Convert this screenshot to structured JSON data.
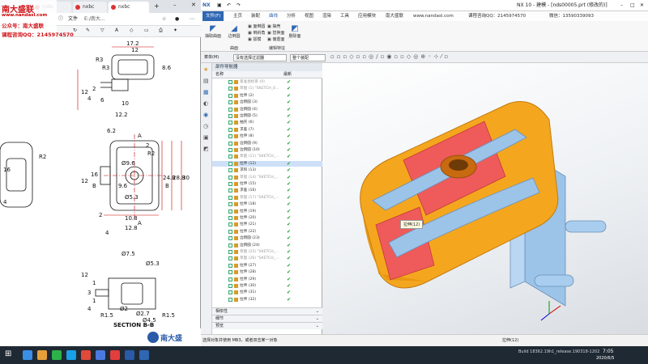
{
  "browser": {
    "tabs": [
      {
        "label": "nxbc"
      },
      {
        "label": "nxbc"
      },
      {
        "label": "nxbc"
      }
    ],
    "address_prefix": "文件",
    "address_path": "E:/南大...",
    "branding": {
      "name": "南大盛联",
      "site": "www.nandasl.com",
      "wechat_label": "公众号：南大盛联",
      "qq_label": "课程咨询QQ：2145974570"
    },
    "drawing": {
      "dims": [
        "17.2",
        "12",
        "R3",
        "R3",
        "8.6",
        "2",
        "4",
        "6",
        "10",
        "12",
        "12.2",
        "6.2",
        "A",
        "A",
        "2",
        "R2",
        "B",
        "B",
        "12",
        "16",
        "9.6",
        "24.8",
        "28.8",
        "30",
        "R2",
        "Ø9.6",
        "Ø5.3",
        "10.8",
        "12.8",
        "2",
        "4",
        "4",
        "Ø7.5",
        "Ø5.3",
        "12",
        "1",
        "3",
        "1",
        "4",
        "R1.5",
        "Ø2.7",
        "R1.5",
        "Ø2",
        "Ø4.5",
        "16"
      ],
      "section_label": "SECTION B-B"
    },
    "bottom_logo": "南大盛"
  },
  "nx": {
    "title": "NX 10 - 建模 - [nds00005.prt (修改的)]",
    "app_label": "NX",
    "menu": [
      "文件(F)",
      "主页",
      "装配",
      "曲线",
      "分析",
      "视图",
      "渲染",
      "工具",
      "应用模块",
      "南大盛联",
      "www.nandasl.com",
      "课程咨询QQ：2145974570",
      "微信：13590339093"
    ],
    "active_menu_index": 3,
    "ribbon": {
      "buttons": [
        "抽取曲面",
        "边倒圆",
        "面倒圆",
        "倒斜角",
        "拔模",
        "抽壳",
        "替换面",
        "偏置面",
        "删除面"
      ],
      "groups": [
        "曲面",
        "编辑特征"
      ]
    },
    "commandbar": {
      "menu_label": "菜单(M)",
      "filter_value": "没有选择过滤器",
      "scope_value": "整个装配"
    },
    "navigator": {
      "title": "部件导航器",
      "col_name": "名称",
      "col_latest": "最新",
      "rows": [
        {
          "label": "基准坐标系 (0)",
          "hidden": true
        },
        {
          "label": "草图 (1) \"SKETCH_0...",
          "hidden": true
        },
        {
          "label": "拉伸 (2)"
        },
        {
          "label": "边倒圆 (3)"
        },
        {
          "label": "边倒圆 (4)"
        },
        {
          "label": "边倒圆 (5)"
        },
        {
          "label": "抽壳 (6)"
        },
        {
          "label": "求差 (7)"
        },
        {
          "label": "拉伸 (8)"
        },
        {
          "label": "边倒圆 (9)"
        },
        {
          "label": "边倒圆 (10)"
        },
        {
          "label": "草图 (11) \"SKETCH_...",
          "hidden": true
        },
        {
          "label": "拉伸 (12)",
          "selected": true
        },
        {
          "label": "求和 (13)"
        },
        {
          "label": "草图 (14) \"SKETCH_...",
          "hidden": true
        },
        {
          "label": "拉伸 (15)"
        },
        {
          "label": "求差 (16)"
        },
        {
          "label": "草图 (17) \"SKETCH_...",
          "hidden": true
        },
        {
          "label": "拉伸 (18)"
        },
        {
          "label": "拉伸 (19)"
        },
        {
          "label": "拉伸 (20)"
        },
        {
          "label": "拉伸 (21)"
        },
        {
          "label": "拉伸 (22)"
        },
        {
          "label": "边倒圆 (23)"
        },
        {
          "label": "边倒圆 (24)"
        },
        {
          "label": "草图 (25) \"SKETCH_...",
          "hidden": true
        },
        {
          "label": "草图 (26) \"SKETCH_...",
          "hidden": true
        },
        {
          "label": "拉伸 (27)"
        },
        {
          "label": "拉伸 (28)"
        },
        {
          "label": "拉伸 (29)"
        },
        {
          "label": "拉伸 (30)"
        },
        {
          "label": "拉伸 (31)"
        },
        {
          "label": "拉伸 (32)"
        }
      ],
      "footers": [
        "相依性",
        "细节",
        "预览"
      ]
    },
    "viewport": {
      "tooltip": "拉伸(12)"
    },
    "status_left": "选择对象并使用 MB3，或者双击某一对象",
    "status_right": "拉伸(12)"
  },
  "taskbar": {
    "time": "7:05",
    "date": "2020/6/5",
    "build": "Build 18362.19h1_release.190318-1202"
  }
}
